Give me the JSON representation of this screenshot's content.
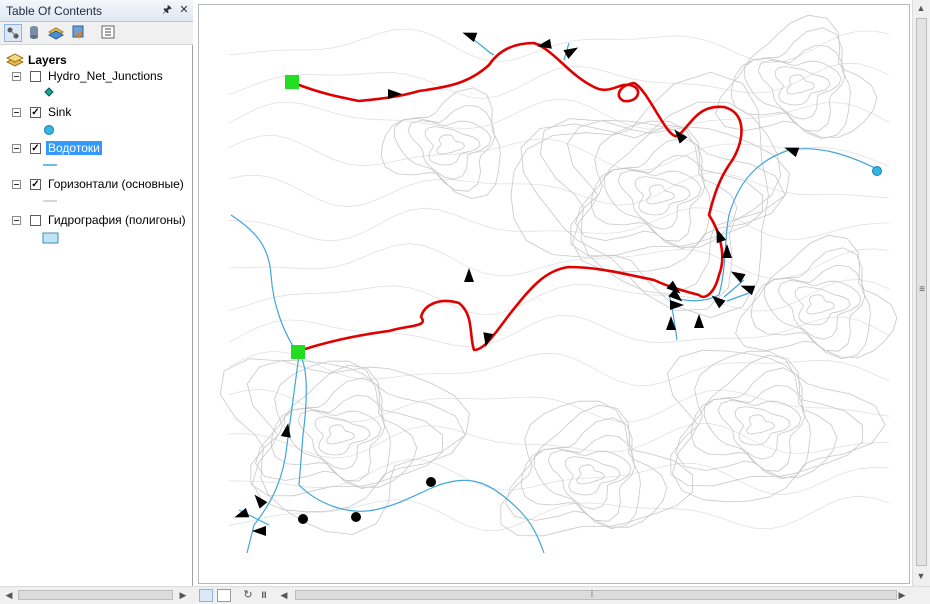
{
  "toc": {
    "title": "Table Of Contents",
    "pin_icon": "pin-icon",
    "close_icon": "close-icon",
    "toolbar": [
      "list-by-drawing-order-icon",
      "list-by-source-icon",
      "list-by-visibility-icon",
      "list-by-selection-icon",
      "options-icon"
    ],
    "root_label": "Layers",
    "layers": [
      {
        "name": "Hydro_Net_Junctions",
        "checked": false,
        "selected": false,
        "symbol": "junction-diamond-icon"
      },
      {
        "name": "Sink",
        "checked": true,
        "selected": false,
        "symbol": "sink-circle-icon"
      },
      {
        "name": "Водотоки",
        "checked": true,
        "selected": true,
        "symbol": "stream-line-icon"
      },
      {
        "name": "Горизонтали (основные)",
        "checked": true,
        "selected": false,
        "symbol": "contour-line-icon"
      },
      {
        "name": "Гидрография (полигоны)",
        "checked": false,
        "selected": false,
        "symbol": "polygon-fill-icon"
      }
    ]
  },
  "map": {
    "colors": {
      "contour": "#c8c8c8",
      "stream": "#3fa6d9",
      "path": "#e00000",
      "endpoint": "#22dd22",
      "sink": "#33b5e5",
      "junction": "#000000"
    },
    "status_buttons": [
      "data-view-icon",
      "layout-view-icon",
      "refresh-icon",
      "pause-icon"
    ]
  }
}
